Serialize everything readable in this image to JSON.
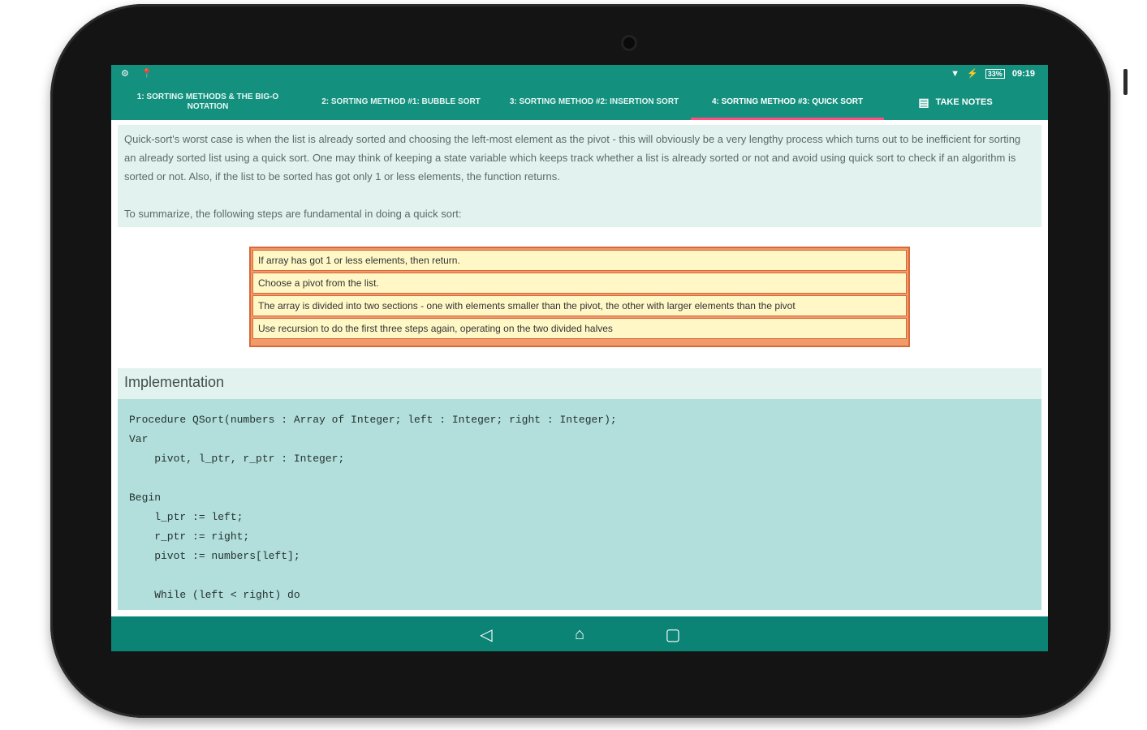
{
  "status_bar": {
    "left_icons": [
      "settings-icon",
      "location-pin-icon"
    ],
    "battery": "33%",
    "time": "09:19"
  },
  "tabs": [
    {
      "label": "1: Sorting Methods & The Big-O Notation"
    },
    {
      "label": "2: Sorting Method #1: Bubble Sort"
    },
    {
      "label": "3: Sorting Method #2: Insertion Sort"
    },
    {
      "label": "4: Sorting Method #3: Quick Sort"
    }
  ],
  "take_notes": {
    "label": "TAKE NOTES",
    "icon": "notes-icon"
  },
  "content": {
    "intro": "Quick-sort's worst case is when the list is already sorted and choosing the left-most element as the pivot - this will obviously be a very lengthy process which turns out to be inefficient for sorting an already sorted list using a quick sort. One may think of keeping a state variable which keeps track whether a list is already sorted or not and avoid using quick sort to check if an algorithm is sorted or not. Also, if the list to be sorted has got only 1 or less elements, the function returns.",
    "summary": "To summarize, the following steps are fundamental in doing a quick sort:",
    "steps": [
      "If array has got 1 or less elements, then return.",
      "Choose a pivot from the list.",
      "The array is divided into two sections - one with elements smaller than the pivot, the other with larger elements than the pivot",
      "Use recursion to do the first three steps again, operating on the two divided halves"
    ],
    "implementation_title": "Implementation",
    "code_lines": [
      "Procedure QSort(numbers : Array of Integer; left : Integer; right : Integer);",
      "Var",
      "    pivot, l_ptr, r_ptr : Integer;",
      "",
      "Begin",
      "    l_ptr := left;",
      "    r_ptr := right;",
      "    pivot := numbers[left];",
      "",
      "    While (left < right) do"
    ]
  },
  "nav_bar": {
    "back_icon": "back-triangle-icon",
    "home_icon": "home-icon",
    "recent_icon": "recent-apps-icon"
  },
  "colors": {
    "toolbar": "#14907f",
    "tab_indicator": "#ff4f7d",
    "code_background": "#b2dfdb",
    "step_background": "#fff8c6",
    "step_border": "#d7683a"
  }
}
